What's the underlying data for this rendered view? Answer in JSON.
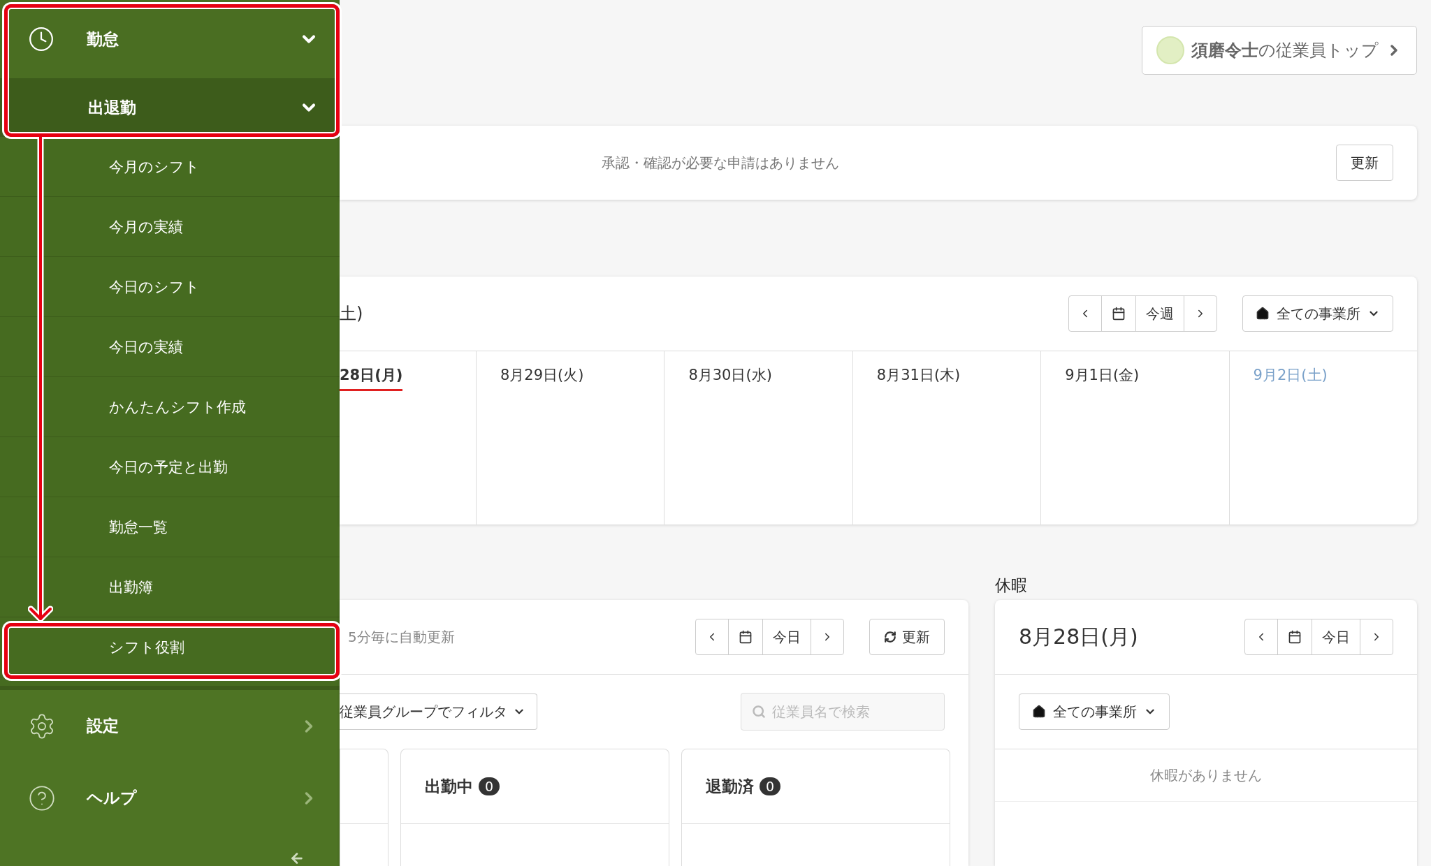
{
  "sidebar": {
    "menu": [
      {
        "label": "勤怠",
        "expanded": true,
        "children": [
          {
            "label": "出退勤",
            "expanded": true,
            "highlighted": true,
            "children": [
              {
                "label": "今月のシフト",
                "highlighted": false
              },
              {
                "label": "今月の実績",
                "highlighted": false
              },
              {
                "label": "今日のシフト",
                "highlighted": false
              },
              {
                "label": "今日の実績",
                "highlighted": false
              },
              {
                "label": "かんたんシフト作成",
                "highlighted": false
              },
              {
                "label": "今日の予定と出勤",
                "highlighted": false
              },
              {
                "label": "勤怠一覧",
                "highlighted": false
              },
              {
                "label": "出勤簿",
                "highlighted": false
              },
              {
                "label": "シフト役割",
                "highlighted": true
              }
            ]
          }
        ]
      },
      {
        "label": "設定",
        "expanded": false
      },
      {
        "label": "ヘルプ",
        "expanded": false
      }
    ]
  },
  "employee_top": {
    "label": "**須磨令士**の従業員トップ"
  },
  "approvals": {
    "message": "承認・確認が必要な申請はありません",
    "button": "更新"
  },
  "week": {
    "title": "土)",
    "pager": {
      "label": "今週"
    },
    "office_select": "全ての事業所",
    "days": [
      {
        "label": "28日(月)",
        "today": true,
        "saturday": false
      },
      {
        "label": "8月29日(火)",
        "today": false,
        "saturday": false
      },
      {
        "label": "8月30日(水)",
        "today": false,
        "saturday": false
      },
      {
        "label": "8月31日(木)",
        "today": false,
        "saturday": false
      },
      {
        "label": "9月1日(金)",
        "today": false,
        "saturday": false
      },
      {
        "label": "9月2日(土)",
        "today": false,
        "saturday": true
      }
    ]
  },
  "attendance": {
    "status": "5分毎に自動更新",
    "pager": {
      "label": "今日"
    },
    "refresh": "更新",
    "group_filter": "従業員グループでフィルタ",
    "search": {
      "placeholder": "従業員名で検索"
    },
    "columns": [
      {
        "title": "出勤中",
        "count": "0"
      },
      {
        "title": "退勤済",
        "count": "0"
      }
    ]
  },
  "leave": {
    "heading": "休暇",
    "date": "8月28日(月)",
    "pager": {
      "label": "今日"
    },
    "office_select": "全ての事業所",
    "empty": "休暇がありません"
  }
}
